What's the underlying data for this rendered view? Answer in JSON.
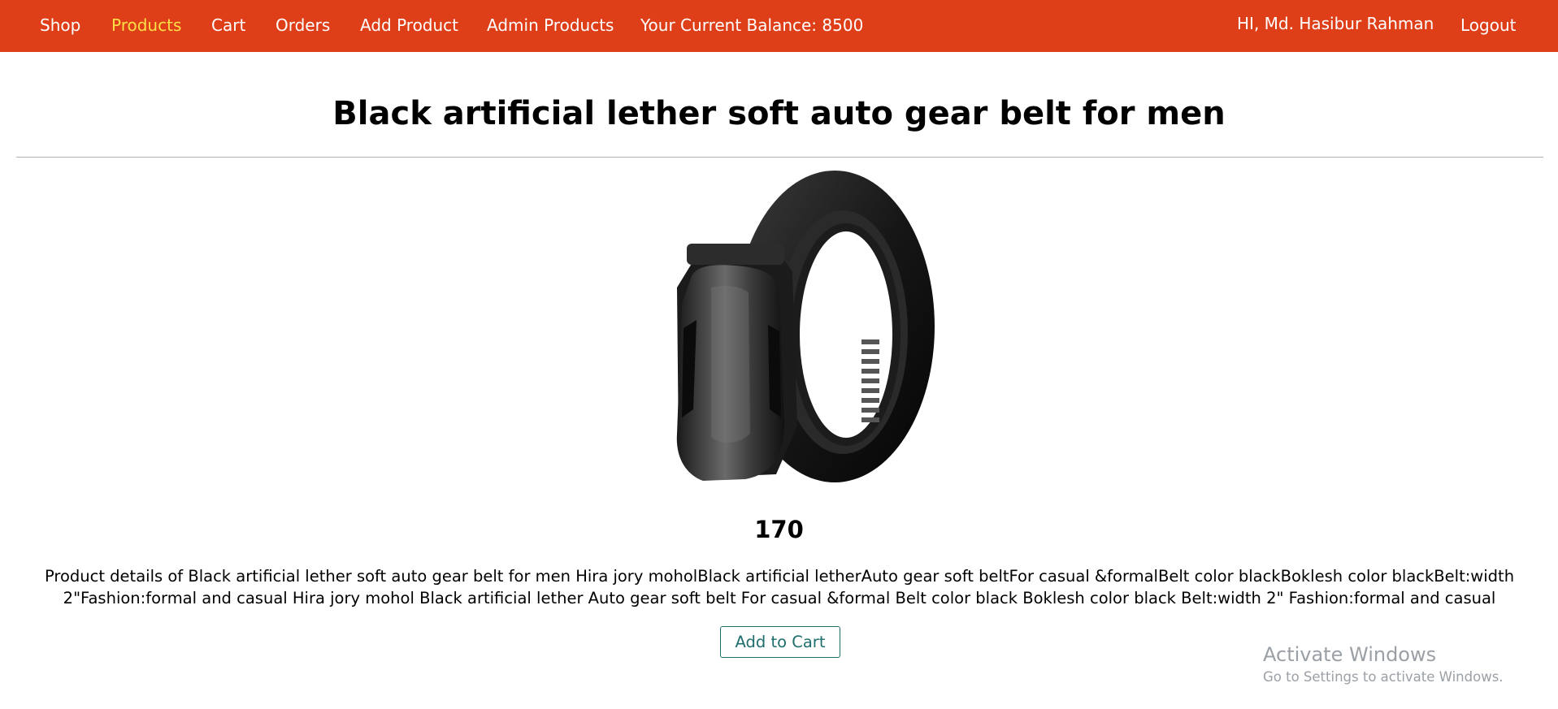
{
  "navbar": {
    "left_items": [
      {
        "label": "Shop",
        "active": false
      },
      {
        "label": "Products",
        "active": true
      },
      {
        "label": "Cart",
        "active": false
      },
      {
        "label": "Orders",
        "active": false
      },
      {
        "label": "Add Product",
        "active": false
      },
      {
        "label": "Admin Products",
        "active": false
      }
    ],
    "balance_text": "Your Current Balance: 8500",
    "greeting": "HI, Md. Hasibur Rahman",
    "logout_label": "Logout",
    "colors": {
      "background": "#de3f18",
      "text": "#ffffff",
      "active": "#fde047"
    }
  },
  "product": {
    "title": "Black artificial lether soft auto gear belt for men",
    "image_alt": "Black artificial lether soft auto gear belt for men",
    "price": "170",
    "description": "Product details of Black artificial lether soft auto gear belt for men Hira jory moholBlack artificial letherAuto gear soft beltFor casual &formalBelt color blackBoklesh color blackBelt:width 2\"Fashion:formal and casual Hira jory mohol Black artificial lether Auto gear soft belt For casual &formal Belt color black Boklesh color black Belt:width 2\" Fashion:formal and casual",
    "add_to_cart_label": "Add to Cart"
  },
  "watermark": {
    "title": "Activate Windows",
    "subtitle": "Go to Settings to activate Windows."
  }
}
